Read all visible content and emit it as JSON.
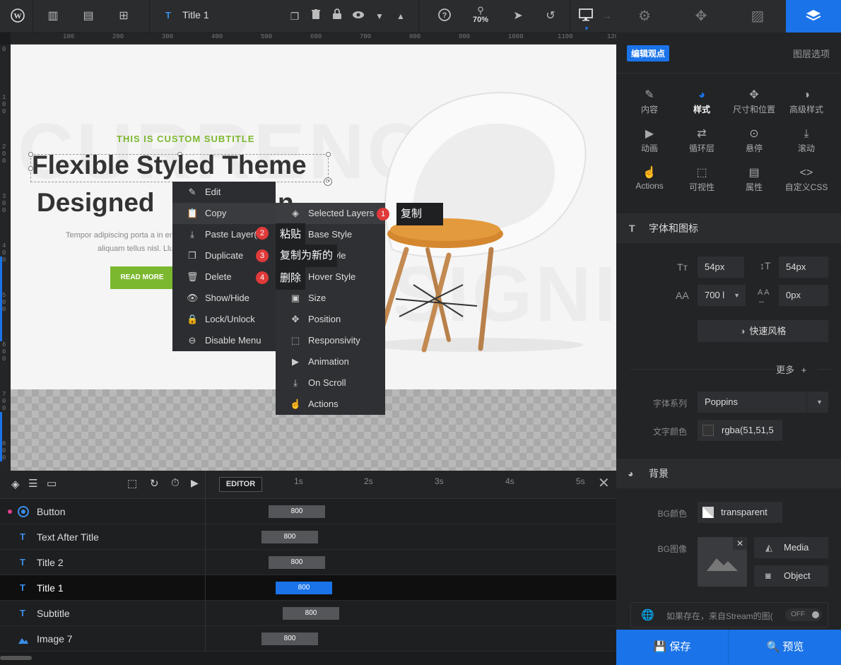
{
  "topbar": {
    "title": "Title 1",
    "zoom": "70%"
  },
  "ruler": {
    "ticks": [
      "100",
      "200",
      "300",
      "400",
      "500",
      "600",
      "700",
      "800",
      "900",
      "1000",
      "1100",
      "120"
    ],
    "v_ticks": [
      "0",
      "1",
      "0",
      "0",
      "2",
      "0",
      "0",
      "3",
      "0",
      "0",
      "4",
      "0",
      "0",
      "5",
      "0",
      "0",
      "6",
      "0",
      "0",
      "7",
      "0",
      "0",
      "8",
      "0",
      "0"
    ]
  },
  "canvas": {
    "bg_text_1": "CURRENC",
    "bg_text_2": "DESIGNIN",
    "subtitle": "THIS IS CUSTOM SUBTITLE",
    "title1": "Flexible Styled Theme",
    "title2": "Designed",
    "title2_tail": "n",
    "body_line1": "Tempor adipiscing porta a in ere",
    "body_line2": "aliquam tellus nisl. Llu",
    "button": "READ MORE"
  },
  "context_menu": {
    "items": [
      {
        "label": "Edit",
        "icon": "pencil-icon"
      },
      {
        "label": "Copy",
        "icon": "clipboard-icon"
      },
      {
        "label": "Paste Layer(s)",
        "icon": "download-icon"
      },
      {
        "label": "Duplicate",
        "icon": "duplicate-icon"
      },
      {
        "label": "Delete",
        "icon": "trash-icon"
      },
      {
        "label": "Show/Hide",
        "icon": "eye-icon"
      },
      {
        "label": "Lock/Unlock",
        "icon": "lock-icon"
      },
      {
        "label": "Disable Menu",
        "icon": "toggle-icon"
      }
    ]
  },
  "submenu": {
    "items": [
      {
        "label": "Selected Layers",
        "icon": "layers-icon"
      },
      {
        "label": "Base Style",
        "icon": "style-icon"
      },
      {
        "label": "Idle Style",
        "icon": "style-icon"
      },
      {
        "label": "Hover Style",
        "icon": "style-icon"
      },
      {
        "label": "Size",
        "icon": "size-icon"
      },
      {
        "label": "Position",
        "icon": "move-icon"
      },
      {
        "label": "Responsivity",
        "icon": "responsive-icon"
      },
      {
        "label": "Animation",
        "icon": "play-icon"
      },
      {
        "label": "On Scroll",
        "icon": "scroll-icon"
      },
      {
        "label": "Actions",
        "icon": "hand-icon"
      }
    ]
  },
  "annotations": [
    {
      "num": "1",
      "text": "复制"
    },
    {
      "num": "2",
      "text": "粘贴"
    },
    {
      "num": "3",
      "text": "复制为新的"
    },
    {
      "num": "4",
      "text": "删除"
    }
  ],
  "timeline": {
    "editor_label": "EDITOR",
    "time_marks": [
      "1s",
      "2s",
      "3s",
      "4s",
      "5s"
    ],
    "layers": [
      {
        "name": "Button",
        "icon": "button-icon",
        "duration": "800"
      },
      {
        "name": "Text After Title",
        "icon": "text-icon",
        "duration": "800"
      },
      {
        "name": "Title 2",
        "icon": "text-icon",
        "duration": "800"
      },
      {
        "name": "Title 1",
        "icon": "text-icon",
        "duration": "800"
      },
      {
        "name": "Subtitle",
        "icon": "text-icon",
        "duration": "800"
      },
      {
        "name": "Image 7",
        "icon": "image-icon",
        "duration": "800"
      }
    ]
  },
  "right_panel": {
    "edit_badge": "编辑观点",
    "layer_options": "图层选项",
    "tabs": [
      {
        "label": "内容",
        "icon": "pencil-icon"
      },
      {
        "label": "样式",
        "icon": "palette-icon"
      },
      {
        "label": "尺寸和位置",
        "icon": "move-icon"
      },
      {
        "label": "高级样式",
        "icon": "contrast-icon"
      },
      {
        "label": "动画",
        "icon": "play-icon"
      },
      {
        "label": "循环层",
        "icon": "loop-icon"
      },
      {
        "label": "悬停",
        "icon": "mouse-icon"
      },
      {
        "label": "滚动",
        "icon": "scroll-icon"
      },
      {
        "label": "Actions",
        "icon": "hand-icon"
      },
      {
        "label": "可视性",
        "icon": "visibility-icon"
      },
      {
        "label": "属性",
        "icon": "file-icon"
      },
      {
        "label": "自定义CSS",
        "icon": "code-icon"
      }
    ],
    "font_section": "字体和图标",
    "font_size": "54px",
    "line_height": "54px",
    "font_weight": "700 l",
    "letter_spacing": "0px",
    "quick_style": "快速风格",
    "more": "更多",
    "font_family_label": "字体系列",
    "font_family": "Poppins",
    "text_color_label": "文字颜色",
    "text_color": "rgba(51,51,5",
    "bg_section": "背景",
    "bg_color_label": "BG颜色",
    "bg_color": "transparent",
    "bg_image_label": "BG图像",
    "media_btn": "Media",
    "object_btn": "Object",
    "stream_text": "如果存在，来自Stream的图(",
    "stream_toggle": "OFF",
    "save": "保存",
    "preview": "预览"
  },
  "colors": {
    "accent": "#1a73e8",
    "green": "#7cb82f",
    "badge_red": "#e03a3a"
  }
}
